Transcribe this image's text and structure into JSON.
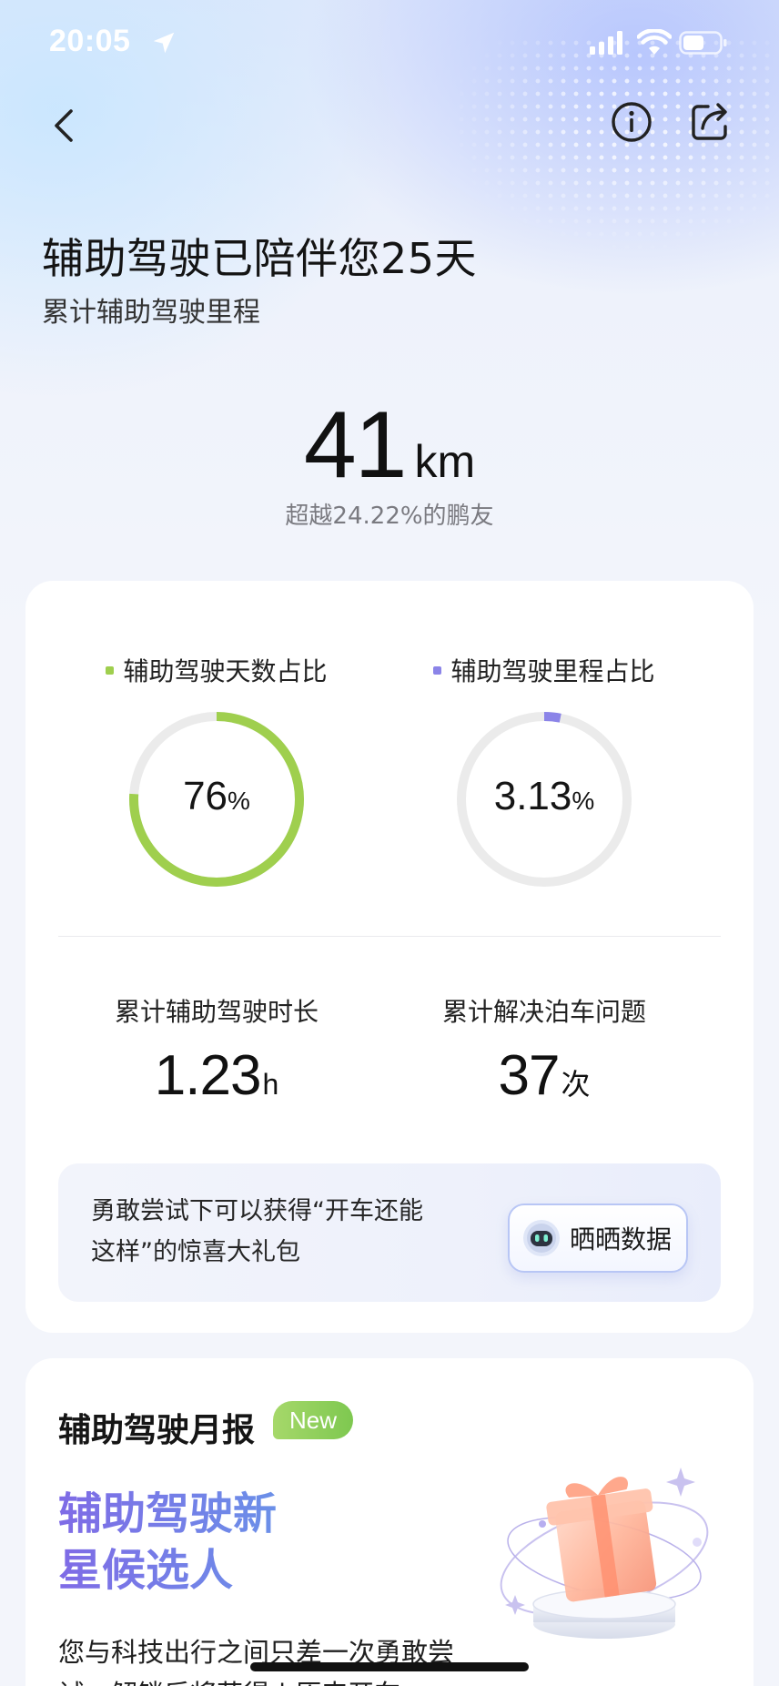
{
  "status_bar": {
    "time": "20:05"
  },
  "header": {
    "title": "辅助驾驶已陪伴您25天",
    "subtitle": "累计辅助驾驶里程"
  },
  "mileage": {
    "value": "41",
    "unit": "km",
    "rank_text": "超越24.22%的鹏友"
  },
  "rings": [
    {
      "label": "辅助驾驶天数占比",
      "value": "76",
      "unit": "%",
      "fraction": 0.76,
      "color": "#9fcf4e"
    },
    {
      "label": "辅助驾驶里程占比",
      "value": "3.13",
      "unit": "%",
      "fraction": 0.0313,
      "color": "#8b84e8"
    }
  ],
  "stats": [
    {
      "label": "累计辅助驾驶时长",
      "value": "1.23",
      "unit": "h"
    },
    {
      "label": "累计解决泊车问题",
      "value": "37",
      "unit": "次"
    }
  ],
  "promo": {
    "text": "勇敢尝试下可以获得“开车还能这样”的惊喜大礼包",
    "button_label": "晒晒数据"
  },
  "monthly": {
    "title": "辅助驾驶月报",
    "badge": "New",
    "headline_line1": "辅助驾驶新",
    "headline_line2": "星候选人",
    "description": "您与科技出行之间只差一次勇敢尝试，解锁后将获得 | 原来开车"
  },
  "icons": {
    "back": "back-arrow-icon",
    "info": "info-icon",
    "share": "share-icon",
    "location": "location-arrow-icon",
    "signal": "cellular-signal-icon",
    "wifi": "wifi-icon",
    "battery": "battery-icon",
    "robot": "robot-icon",
    "gift": "gift-box-illustration"
  }
}
